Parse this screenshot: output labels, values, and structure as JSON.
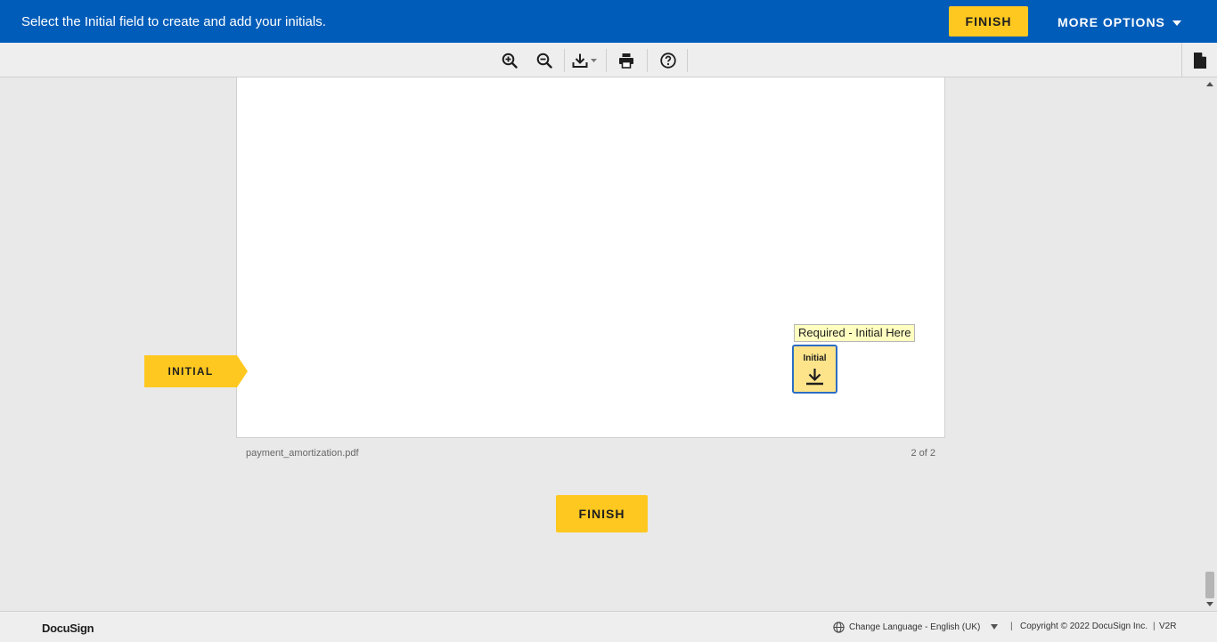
{
  "header": {
    "message": "Select the Initial field to create and add your initials.",
    "finish_label": "FINISH",
    "more_options_label": "MORE OPTIONS"
  },
  "toolbar": {
    "icons": [
      "zoom-in-icon",
      "zoom-out-icon",
      "download-icon",
      "print-icon",
      "help-icon",
      "document-icon"
    ]
  },
  "document": {
    "file_name": "payment_amortization.pdf",
    "page_indicator": "2 of 2",
    "tooltip": "Required - Initial Here",
    "field_label": "Initial",
    "field_icon": "download-arrow-icon",
    "tag_label": "INITIAL"
  },
  "bottom": {
    "finish_label": "FINISH"
  },
  "footer": {
    "logo": "DocuSign",
    "language": "Change Language - English (UK)",
    "separator": "|",
    "copyright": "Copyright © 2022 DocuSign Inc.",
    "version": "V2R"
  },
  "colors": {
    "header_bg": "#005cb9",
    "accent_yellow": "#ffc820",
    "field_bg": "#fde48a",
    "field_border": "#2c6cc3",
    "tooltip_bg": "#ffffc0",
    "app_bg": "#e9e9e9"
  }
}
